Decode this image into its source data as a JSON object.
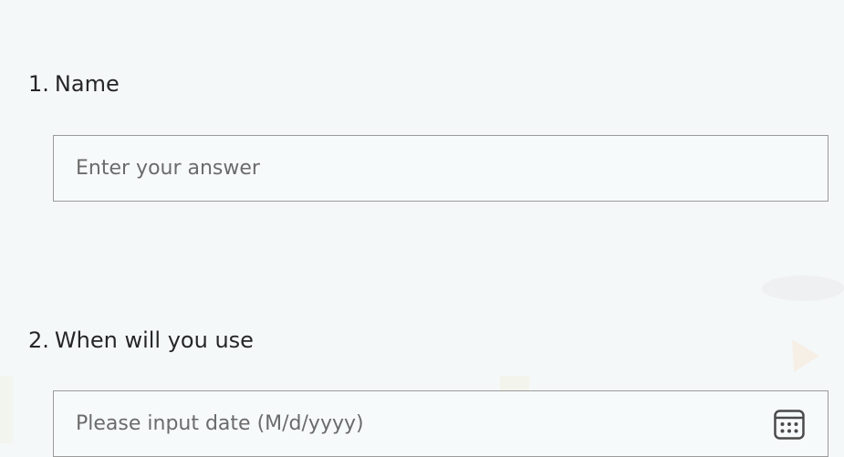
{
  "form": {
    "questions": [
      {
        "number": "1.",
        "title": "Name",
        "placeholder": "Enter your answer",
        "value": ""
      },
      {
        "number": "2.",
        "title": "When will you use",
        "placeholder": "Please input date (M/d/yyyy)",
        "value": "",
        "icon": "calendar-icon"
      }
    ]
  },
  "colors": {
    "background": "#f5f8f9",
    "text": "#262626",
    "placeholder": "#6b6b6b",
    "border": "#9b9b9b"
  }
}
